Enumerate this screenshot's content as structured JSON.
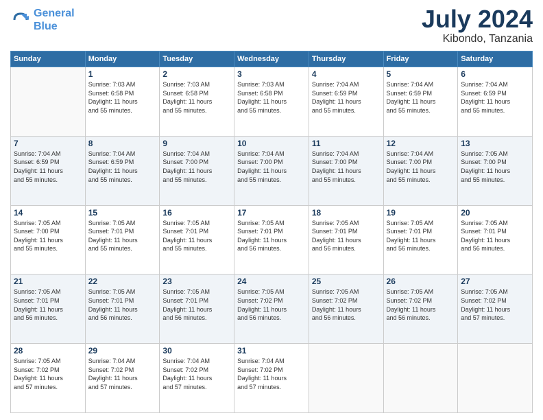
{
  "header": {
    "logo_line1": "General",
    "logo_line2": "Blue",
    "month": "July 2024",
    "location": "Kibondo, Tanzania"
  },
  "weekdays": [
    "Sunday",
    "Monday",
    "Tuesday",
    "Wednesday",
    "Thursday",
    "Friday",
    "Saturday"
  ],
  "weeks": [
    [
      {
        "date": "",
        "info": ""
      },
      {
        "date": "1",
        "info": "Sunrise: 7:03 AM\nSunset: 6:58 PM\nDaylight: 11 hours\nand 55 minutes."
      },
      {
        "date": "2",
        "info": "Sunrise: 7:03 AM\nSunset: 6:58 PM\nDaylight: 11 hours\nand 55 minutes."
      },
      {
        "date": "3",
        "info": "Sunrise: 7:03 AM\nSunset: 6:58 PM\nDaylight: 11 hours\nand 55 minutes."
      },
      {
        "date": "4",
        "info": "Sunrise: 7:04 AM\nSunset: 6:59 PM\nDaylight: 11 hours\nand 55 minutes."
      },
      {
        "date": "5",
        "info": "Sunrise: 7:04 AM\nSunset: 6:59 PM\nDaylight: 11 hours\nand 55 minutes."
      },
      {
        "date": "6",
        "info": "Sunrise: 7:04 AM\nSunset: 6:59 PM\nDaylight: 11 hours\nand 55 minutes."
      }
    ],
    [
      {
        "date": "7",
        "info": "Sunrise: 7:04 AM\nSunset: 6:59 PM\nDaylight: 11 hours\nand 55 minutes."
      },
      {
        "date": "8",
        "info": "Sunrise: 7:04 AM\nSunset: 6:59 PM\nDaylight: 11 hours\nand 55 minutes."
      },
      {
        "date": "9",
        "info": "Sunrise: 7:04 AM\nSunset: 7:00 PM\nDaylight: 11 hours\nand 55 minutes."
      },
      {
        "date": "10",
        "info": "Sunrise: 7:04 AM\nSunset: 7:00 PM\nDaylight: 11 hours\nand 55 minutes."
      },
      {
        "date": "11",
        "info": "Sunrise: 7:04 AM\nSunset: 7:00 PM\nDaylight: 11 hours\nand 55 minutes."
      },
      {
        "date": "12",
        "info": "Sunrise: 7:04 AM\nSunset: 7:00 PM\nDaylight: 11 hours\nand 55 minutes."
      },
      {
        "date": "13",
        "info": "Sunrise: 7:05 AM\nSunset: 7:00 PM\nDaylight: 11 hours\nand 55 minutes."
      }
    ],
    [
      {
        "date": "14",
        "info": "Sunrise: 7:05 AM\nSunset: 7:00 PM\nDaylight: 11 hours\nand 55 minutes."
      },
      {
        "date": "15",
        "info": "Sunrise: 7:05 AM\nSunset: 7:01 PM\nDaylight: 11 hours\nand 55 minutes."
      },
      {
        "date": "16",
        "info": "Sunrise: 7:05 AM\nSunset: 7:01 PM\nDaylight: 11 hours\nand 55 minutes."
      },
      {
        "date": "17",
        "info": "Sunrise: 7:05 AM\nSunset: 7:01 PM\nDaylight: 11 hours\nand 56 minutes."
      },
      {
        "date": "18",
        "info": "Sunrise: 7:05 AM\nSunset: 7:01 PM\nDaylight: 11 hours\nand 56 minutes."
      },
      {
        "date": "19",
        "info": "Sunrise: 7:05 AM\nSunset: 7:01 PM\nDaylight: 11 hours\nand 56 minutes."
      },
      {
        "date": "20",
        "info": "Sunrise: 7:05 AM\nSunset: 7:01 PM\nDaylight: 11 hours\nand 56 minutes."
      }
    ],
    [
      {
        "date": "21",
        "info": "Sunrise: 7:05 AM\nSunset: 7:01 PM\nDaylight: 11 hours\nand 56 minutes."
      },
      {
        "date": "22",
        "info": "Sunrise: 7:05 AM\nSunset: 7:01 PM\nDaylight: 11 hours\nand 56 minutes."
      },
      {
        "date": "23",
        "info": "Sunrise: 7:05 AM\nSunset: 7:01 PM\nDaylight: 11 hours\nand 56 minutes."
      },
      {
        "date": "24",
        "info": "Sunrise: 7:05 AM\nSunset: 7:02 PM\nDaylight: 11 hours\nand 56 minutes."
      },
      {
        "date": "25",
        "info": "Sunrise: 7:05 AM\nSunset: 7:02 PM\nDaylight: 11 hours\nand 56 minutes."
      },
      {
        "date": "26",
        "info": "Sunrise: 7:05 AM\nSunset: 7:02 PM\nDaylight: 11 hours\nand 56 minutes."
      },
      {
        "date": "27",
        "info": "Sunrise: 7:05 AM\nSunset: 7:02 PM\nDaylight: 11 hours\nand 57 minutes."
      }
    ],
    [
      {
        "date": "28",
        "info": "Sunrise: 7:05 AM\nSunset: 7:02 PM\nDaylight: 11 hours\nand 57 minutes."
      },
      {
        "date": "29",
        "info": "Sunrise: 7:04 AM\nSunset: 7:02 PM\nDaylight: 11 hours\nand 57 minutes."
      },
      {
        "date": "30",
        "info": "Sunrise: 7:04 AM\nSunset: 7:02 PM\nDaylight: 11 hours\nand 57 minutes."
      },
      {
        "date": "31",
        "info": "Sunrise: 7:04 AM\nSunset: 7:02 PM\nDaylight: 11 hours\nand 57 minutes."
      },
      {
        "date": "",
        "info": ""
      },
      {
        "date": "",
        "info": ""
      },
      {
        "date": "",
        "info": ""
      }
    ]
  ]
}
